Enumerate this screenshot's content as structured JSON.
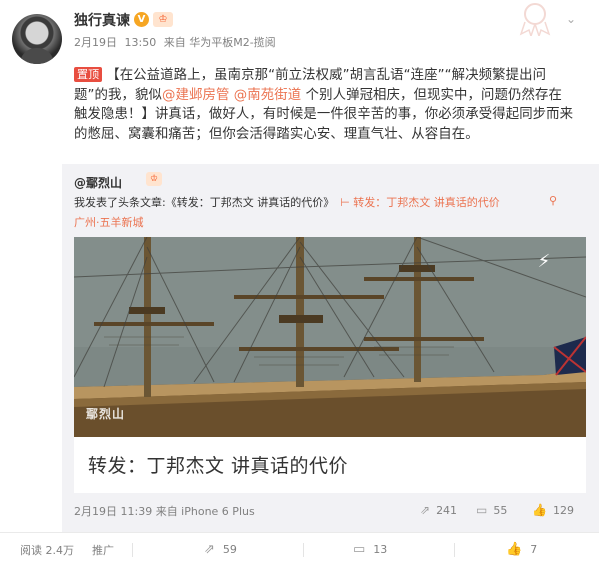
{
  "post": {
    "username": "独行真谏",
    "verified_badge": "V",
    "crown_badge": "♔",
    "meta": {
      "date": "2月19日",
      "time": "13:50",
      "source": "来自 华为平板M2-揽阅"
    },
    "pin_label": "置顶",
    "text_part1": "【在公益道路上，虽南京那“前立法权威”胡言乱语“连座”“解决频繁提出问题”的我，貌似",
    "mention1": "@建邺房管",
    "mention2": "@南苑街道",
    "text_part2": "个别人弹冠相庆，但现实中，问题仍然存在触发隐患！】讲真话，做好人，有时候是一件很辛苦的事，你必须承受得起同步而来的憋屈、窝囊和痛苦；但你会活得踏实心安、理直气壮、从容自在。"
  },
  "repost": {
    "orig_user": "@鄢烈山",
    "orig_text_prefix": "我发表了头条文章:《转发：丁邦杰文 讲真话的代价》",
    "link_icon": "⊢",
    "link_text": "转发：丁邦杰文 讲真话的代价",
    "location": "广州·五羊新城",
    "article": {
      "watermark": "鄢烈山",
      "title": "转发：丁邦杰文 讲真话的代价",
      "flash_icon": "⚡"
    },
    "time": "2月19日 11:39 来自 iPhone 6 Plus",
    "stats": {
      "forward": "241",
      "comment": "55",
      "like": "129"
    }
  },
  "footer": {
    "reads": "阅读 2.4万",
    "promote": "推广",
    "forward": "59",
    "comment": "13",
    "like": "7"
  },
  "colors": {
    "accent": "#eb7350",
    "pin": "#e84e40",
    "gray_text": "#808080",
    "repost_bg": "#f2f2f5"
  }
}
